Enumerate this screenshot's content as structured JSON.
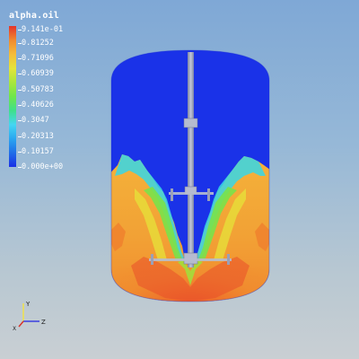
{
  "legend": {
    "title": "alpha.oil",
    "gradient_colors": [
      "#1a2fe6",
      "#2aa6f0",
      "#45d6f2",
      "#3fe08a",
      "#a9e63d",
      "#e5e43a",
      "#f4bc3a",
      "#f08a2e",
      "#e4342a"
    ],
    "labels": [
      "9.141e-01",
      "0.81252",
      "0.71096",
      "0.60939",
      "0.50783",
      "0.40626",
      "0.3047",
      "0.20313",
      "0.10157",
      "0.000e+00"
    ]
  },
  "axes": {
    "y_label": "Y",
    "z_label": "Z",
    "x_label": "X"
  },
  "scene_colors": {
    "background_top": "#7fa8d6",
    "background_bottom": "#c9cfd3",
    "low_value": "#1a2fe6",
    "high_value": "#e4342a",
    "shaft": "#9aa0b8"
  }
}
